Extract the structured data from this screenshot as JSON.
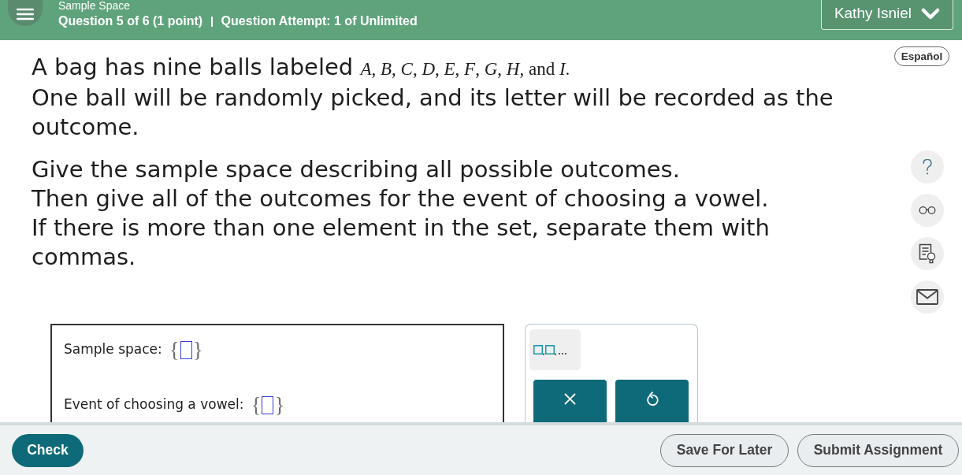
{
  "header": {
    "title": "Sample Space",
    "question_info": "Question 5 of 6 (1 point)",
    "attempt_info": "Question Attempt: 1 of Unlimited",
    "user": "Kathy Isniel"
  },
  "language_button": "Español",
  "question": {
    "paragraphs": [
      [
        {
          "text": "A bag has nine balls labeled",
          "math": "*A*, *B*, *C*, *D*, *E*, *F*, *G*, *H*, and *I*."
        },
        {
          "text": "One ball will be randomly picked, and its letter will be recorded as the outcome."
        }
      ],
      [
        {
          "text": "Give the sample space describing all possible outcomes."
        },
        {
          "text": "Then give all of the outcomes for the event of choosing a vowel."
        },
        {
          "text": "If there is more than one element in the set, separate them with commas."
        }
      ]
    ]
  },
  "answers": [
    {
      "label": "Sample space:",
      "open_brace": "{",
      "close_brace": "}"
    },
    {
      "label": "Event of choosing a vowel:",
      "open_brace": "{",
      "close_brace": "}"
    }
  ],
  "footer": {
    "check": "Check",
    "buttons": [
      "Save For Later",
      "Submit Assignment"
    ]
  }
}
